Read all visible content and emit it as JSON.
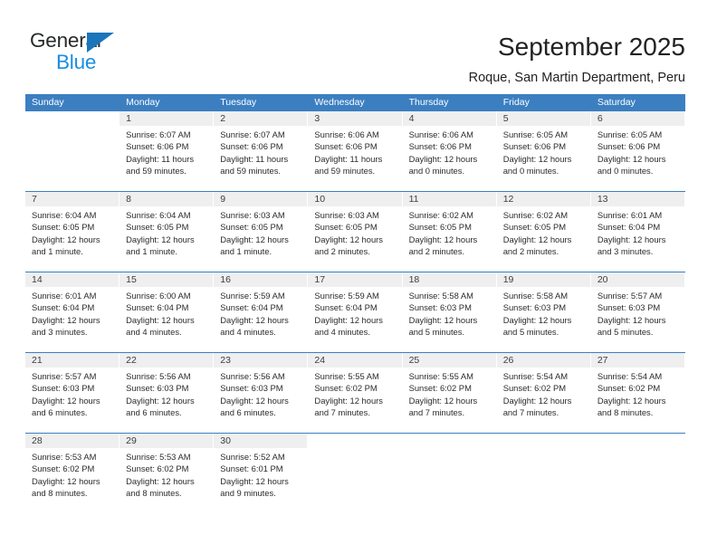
{
  "brand": {
    "name_top": "General",
    "name_bottom": "Blue",
    "accent_color": "#1b8ee0",
    "triangle_color": "#1b75bb"
  },
  "header": {
    "title": "September 2025",
    "location": "Roque, San Martin Department, Peru"
  },
  "calendar": {
    "header_color": "#3c7fc1",
    "day_band_color": "#efefef",
    "weekdays": [
      "Sunday",
      "Monday",
      "Tuesday",
      "Wednesday",
      "Thursday",
      "Friday",
      "Saturday"
    ],
    "weeks": [
      [
        {
          "day": "",
          "blank": true,
          "lines": []
        },
        {
          "day": "1",
          "lines": [
            "Sunrise: 6:07 AM",
            "Sunset: 6:06 PM",
            "Daylight: 11 hours",
            "and 59 minutes."
          ]
        },
        {
          "day": "2",
          "lines": [
            "Sunrise: 6:07 AM",
            "Sunset: 6:06 PM",
            "Daylight: 11 hours",
            "and 59 minutes."
          ]
        },
        {
          "day": "3",
          "lines": [
            "Sunrise: 6:06 AM",
            "Sunset: 6:06 PM",
            "Daylight: 11 hours",
            "and 59 minutes."
          ]
        },
        {
          "day": "4",
          "lines": [
            "Sunrise: 6:06 AM",
            "Sunset: 6:06 PM",
            "Daylight: 12 hours",
            "and 0 minutes."
          ]
        },
        {
          "day": "5",
          "lines": [
            "Sunrise: 6:05 AM",
            "Sunset: 6:06 PM",
            "Daylight: 12 hours",
            "and 0 minutes."
          ]
        },
        {
          "day": "6",
          "lines": [
            "Sunrise: 6:05 AM",
            "Sunset: 6:06 PM",
            "Daylight: 12 hours",
            "and 0 minutes."
          ]
        }
      ],
      [
        {
          "day": "7",
          "lines": [
            "Sunrise: 6:04 AM",
            "Sunset: 6:05 PM",
            "Daylight: 12 hours",
            "and 1 minute."
          ]
        },
        {
          "day": "8",
          "lines": [
            "Sunrise: 6:04 AM",
            "Sunset: 6:05 PM",
            "Daylight: 12 hours",
            "and 1 minute."
          ]
        },
        {
          "day": "9",
          "lines": [
            "Sunrise: 6:03 AM",
            "Sunset: 6:05 PM",
            "Daylight: 12 hours",
            "and 1 minute."
          ]
        },
        {
          "day": "10",
          "lines": [
            "Sunrise: 6:03 AM",
            "Sunset: 6:05 PM",
            "Daylight: 12 hours",
            "and 2 minutes."
          ]
        },
        {
          "day": "11",
          "lines": [
            "Sunrise: 6:02 AM",
            "Sunset: 6:05 PM",
            "Daylight: 12 hours",
            "and 2 minutes."
          ]
        },
        {
          "day": "12",
          "lines": [
            "Sunrise: 6:02 AM",
            "Sunset: 6:05 PM",
            "Daylight: 12 hours",
            "and 2 minutes."
          ]
        },
        {
          "day": "13",
          "lines": [
            "Sunrise: 6:01 AM",
            "Sunset: 6:04 PM",
            "Daylight: 12 hours",
            "and 3 minutes."
          ]
        }
      ],
      [
        {
          "day": "14",
          "lines": [
            "Sunrise: 6:01 AM",
            "Sunset: 6:04 PM",
            "Daylight: 12 hours",
            "and 3 minutes."
          ]
        },
        {
          "day": "15",
          "lines": [
            "Sunrise: 6:00 AM",
            "Sunset: 6:04 PM",
            "Daylight: 12 hours",
            "and 4 minutes."
          ]
        },
        {
          "day": "16",
          "lines": [
            "Sunrise: 5:59 AM",
            "Sunset: 6:04 PM",
            "Daylight: 12 hours",
            "and 4 minutes."
          ]
        },
        {
          "day": "17",
          "lines": [
            "Sunrise: 5:59 AM",
            "Sunset: 6:04 PM",
            "Daylight: 12 hours",
            "and 4 minutes."
          ]
        },
        {
          "day": "18",
          "lines": [
            "Sunrise: 5:58 AM",
            "Sunset: 6:03 PM",
            "Daylight: 12 hours",
            "and 5 minutes."
          ]
        },
        {
          "day": "19",
          "lines": [
            "Sunrise: 5:58 AM",
            "Sunset: 6:03 PM",
            "Daylight: 12 hours",
            "and 5 minutes."
          ]
        },
        {
          "day": "20",
          "lines": [
            "Sunrise: 5:57 AM",
            "Sunset: 6:03 PM",
            "Daylight: 12 hours",
            "and 5 minutes."
          ]
        }
      ],
      [
        {
          "day": "21",
          "lines": [
            "Sunrise: 5:57 AM",
            "Sunset: 6:03 PM",
            "Daylight: 12 hours",
            "and 6 minutes."
          ]
        },
        {
          "day": "22",
          "lines": [
            "Sunrise: 5:56 AM",
            "Sunset: 6:03 PM",
            "Daylight: 12 hours",
            "and 6 minutes."
          ]
        },
        {
          "day": "23",
          "lines": [
            "Sunrise: 5:56 AM",
            "Sunset: 6:03 PM",
            "Daylight: 12 hours",
            "and 6 minutes."
          ]
        },
        {
          "day": "24",
          "lines": [
            "Sunrise: 5:55 AM",
            "Sunset: 6:02 PM",
            "Daylight: 12 hours",
            "and 7 minutes."
          ]
        },
        {
          "day": "25",
          "lines": [
            "Sunrise: 5:55 AM",
            "Sunset: 6:02 PM",
            "Daylight: 12 hours",
            "and 7 minutes."
          ]
        },
        {
          "day": "26",
          "lines": [
            "Sunrise: 5:54 AM",
            "Sunset: 6:02 PM",
            "Daylight: 12 hours",
            "and 7 minutes."
          ]
        },
        {
          "day": "27",
          "lines": [
            "Sunrise: 5:54 AM",
            "Sunset: 6:02 PM",
            "Daylight: 12 hours",
            "and 8 minutes."
          ]
        }
      ],
      [
        {
          "day": "28",
          "lines": [
            "Sunrise: 5:53 AM",
            "Sunset: 6:02 PM",
            "Daylight: 12 hours",
            "and 8 minutes."
          ]
        },
        {
          "day": "29",
          "lines": [
            "Sunrise: 5:53 AM",
            "Sunset: 6:02 PM",
            "Daylight: 12 hours",
            "and 8 minutes."
          ]
        },
        {
          "day": "30",
          "lines": [
            "Sunrise: 5:52 AM",
            "Sunset: 6:01 PM",
            "Daylight: 12 hours",
            "and 9 minutes."
          ]
        },
        {
          "day": "",
          "blank": true,
          "lines": []
        },
        {
          "day": "",
          "blank": true,
          "lines": []
        },
        {
          "day": "",
          "blank": true,
          "lines": []
        },
        {
          "day": "",
          "blank": true,
          "lines": []
        }
      ]
    ]
  }
}
